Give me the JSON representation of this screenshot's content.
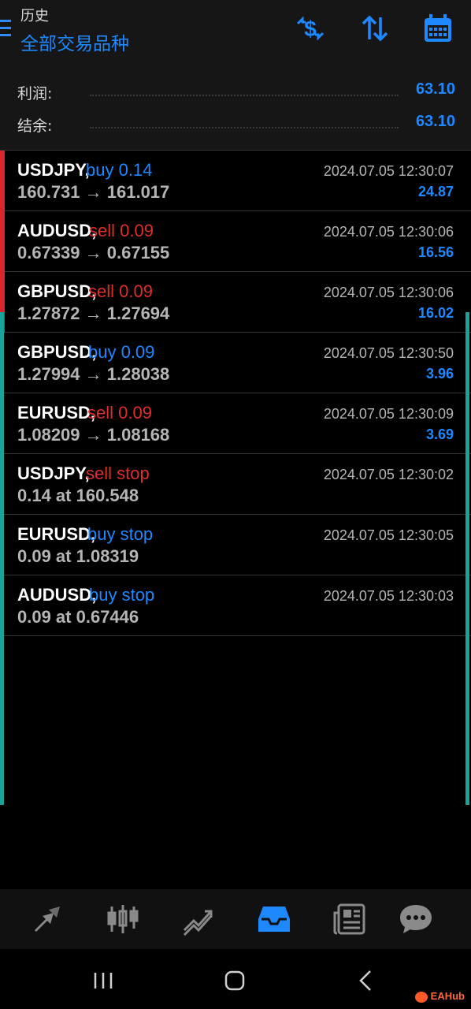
{
  "header": {
    "subtitle": "历史",
    "title": "全部交易品种",
    "icons": [
      "menu-icon",
      "currency-exchange-icon",
      "sort-icon",
      "calendar-icon"
    ]
  },
  "summary": {
    "profit_label": "利润:",
    "profit_value": "63.10",
    "balance_label": "结余:",
    "balance_value": "63.10"
  },
  "trades": [
    {
      "symbol": "USDJPY,",
      "action": "buy 0.14",
      "action_type": "buy",
      "prices": "160.731 → 161.017",
      "time": "2024.07.05 12:30:07",
      "profit": "24.87"
    },
    {
      "symbol": "AUDUSD,",
      "action": "sell 0.09",
      "action_type": "sell",
      "prices": "0.67339 → 0.67155",
      "time": "2024.07.05 12:30:06",
      "profit": "16.56"
    },
    {
      "symbol": "GBPUSD,",
      "action": "sell 0.09",
      "action_type": "sell",
      "prices": "1.27872 → 1.27694",
      "time": "2024.07.05 12:30:06",
      "profit": "16.02"
    },
    {
      "symbol": "GBPUSD,",
      "action": "buy 0.09",
      "action_type": "buy",
      "prices": "1.27994 → 1.28038",
      "time": "2024.07.05 12:30:50",
      "profit": "3.96"
    },
    {
      "symbol": "EURUSD,",
      "action": "sell 0.09",
      "action_type": "sell",
      "prices": "1.08209 → 1.08168",
      "time": "2024.07.05 12:30:09",
      "profit": "3.69"
    },
    {
      "symbol": "USDJPY,",
      "action": "sell stop",
      "action_type": "sell",
      "prices": "0.14 at 160.548",
      "time": "2024.07.05 12:30:02",
      "profit": ""
    },
    {
      "symbol": "EURUSD,",
      "action": "buy stop",
      "action_type": "buy",
      "prices": "0.09 at 1.08319",
      "time": "2024.07.05 12:30:05",
      "profit": ""
    },
    {
      "symbol": "AUDUSD,",
      "action": "buy stop",
      "action_type": "buy",
      "prices": "0.09 at 0.67446",
      "time": "2024.07.05 12:30:03",
      "profit": ""
    }
  ],
  "bottom_nav": [
    "quotes-icon",
    "chart-icon",
    "trade-icon",
    "history-icon",
    "news-icon",
    "chat-icon"
  ],
  "bottom_nav_active": "history-icon",
  "watermark": "EAHub",
  "colors": {
    "accent": "#1e88ff",
    "sell": "#e02c2c",
    "marker": "#d8262a",
    "teal": "#1aa39a"
  }
}
